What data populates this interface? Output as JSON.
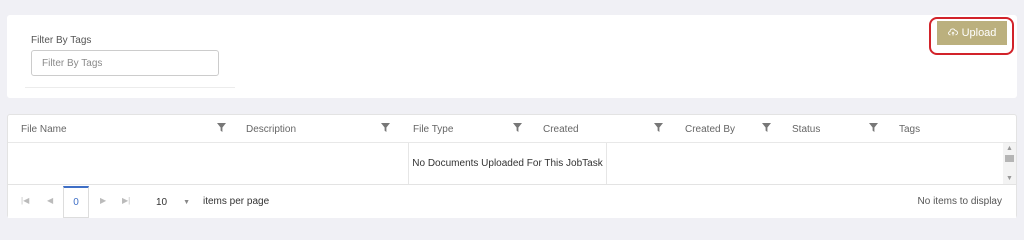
{
  "filter": {
    "label": "Filter By Tags",
    "placeholder": "Filter By Tags"
  },
  "upload": {
    "label": "Upload",
    "icon": "cloud-upload-icon",
    "highlight_color": "#d2232a",
    "button_color": "#bbb07e"
  },
  "grid": {
    "columns": [
      {
        "title": "File Name",
        "filterable": true
      },
      {
        "title": "Description",
        "filterable": true
      },
      {
        "title": "File Type",
        "filterable": true
      },
      {
        "title": "Created",
        "filterable": true
      },
      {
        "title": "Created By",
        "filterable": true
      },
      {
        "title": "Status",
        "filterable": true
      },
      {
        "title": "Tags",
        "filterable": false
      }
    ],
    "no_records": "No Documents Uploaded For This JobTask"
  },
  "pager": {
    "first_icon": "first-page-icon",
    "prev_icon": "prev-page-icon",
    "current_page": "0",
    "next_icon": "next-page-icon",
    "last_icon": "last-page-icon",
    "page_size": "10",
    "page_size_label": "items per page",
    "info": "No items to display"
  }
}
